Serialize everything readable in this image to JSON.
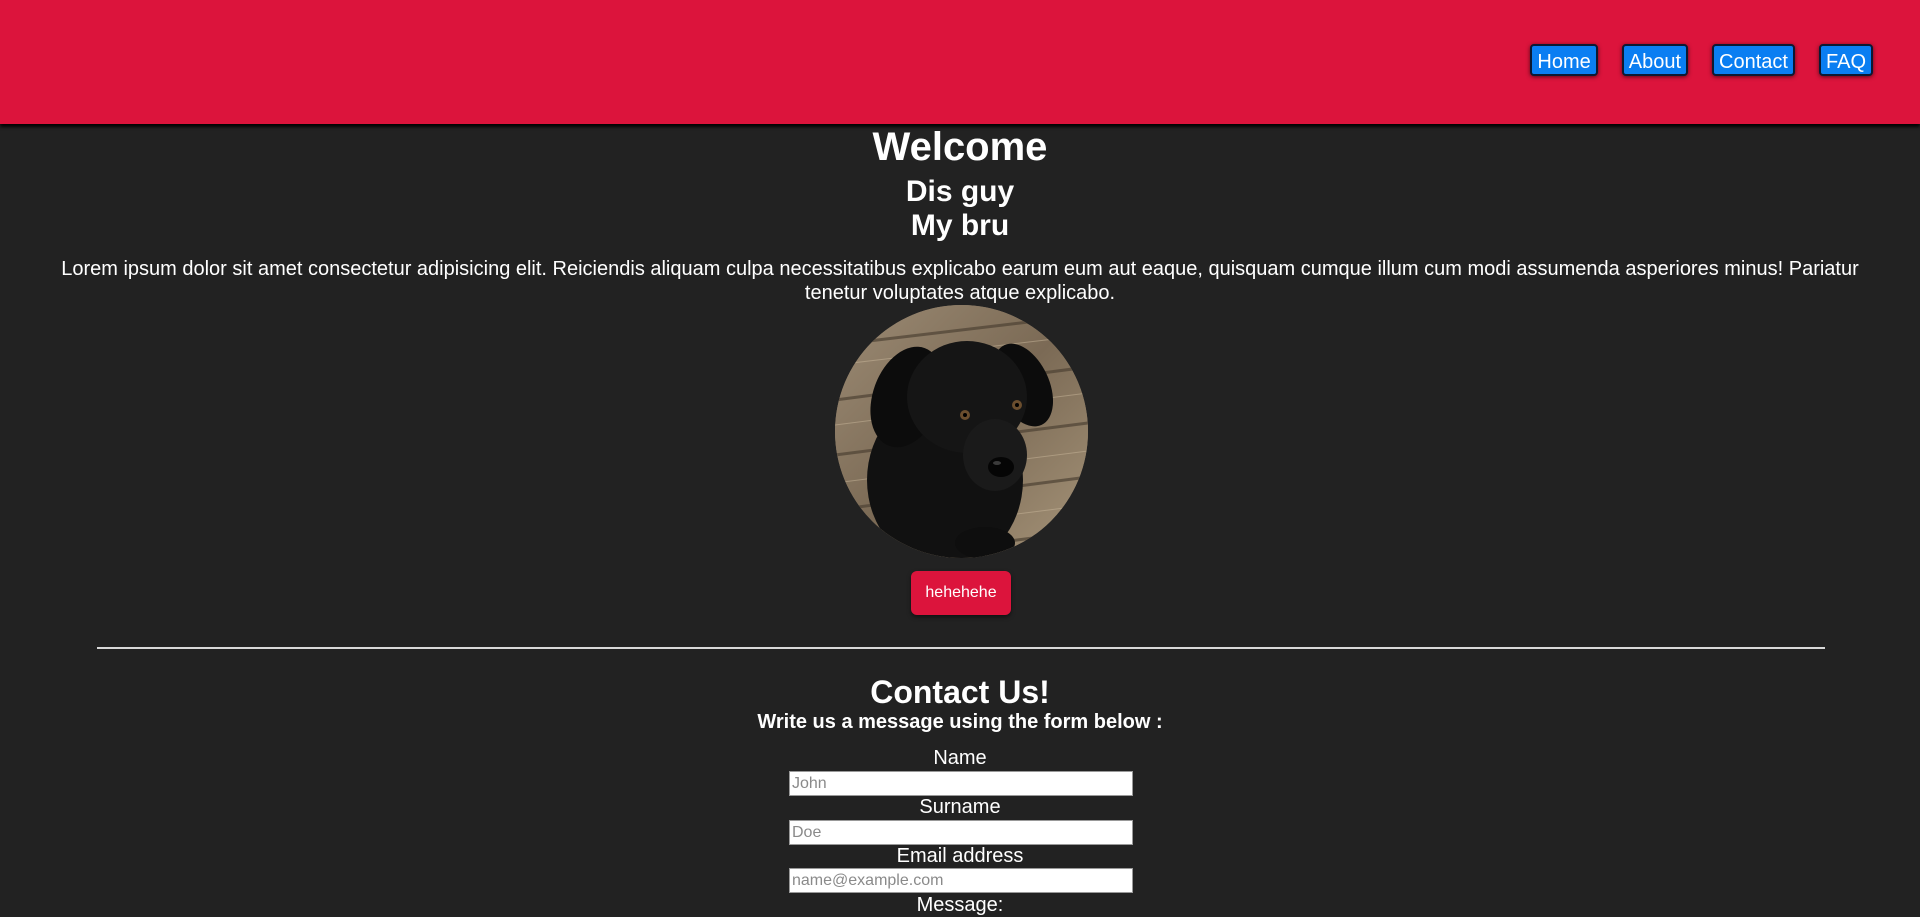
{
  "colors": {
    "header_bg": "#dc143c",
    "page_bg": "#222222",
    "nav_button_bg": "#0a7ef2",
    "accent_button_bg": "#dc143c"
  },
  "nav": {
    "items": [
      {
        "label": "Home"
      },
      {
        "label": "About"
      },
      {
        "label": "Contact"
      },
      {
        "label": "FAQ"
      }
    ]
  },
  "hero": {
    "title": "Welcome",
    "subtitle1": "Dis guy",
    "subtitle2": "My bru",
    "body": "Lorem ipsum dolor sit amet consectetur adipisicing elit. Reiciendis aliquam culpa necessitatibus explicabo earum eum aut eaque, quisquam cumque illum cum modi assumenda asperiores minus! Pariatur tenetur voluptates atque explicabo.",
    "image": "black-puppy-photo",
    "button_label": "hehehehe"
  },
  "contact": {
    "title": "Contact Us!",
    "subtitle": "Write us a message using the form below :",
    "fields": {
      "name": {
        "label": "Name",
        "placeholder": "John"
      },
      "surname": {
        "label": "Surname",
        "placeholder": "Doe"
      },
      "email": {
        "label": "Email address",
        "placeholder": "name@example.com"
      },
      "message": {
        "label": "Message:"
      }
    }
  }
}
